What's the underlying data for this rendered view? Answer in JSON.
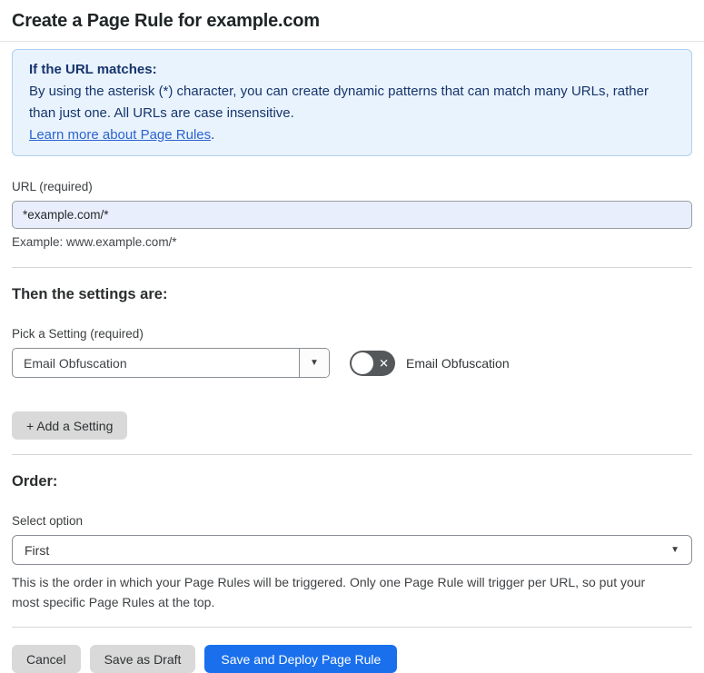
{
  "page": {
    "title": "Create a Page Rule for example.com"
  },
  "info_box": {
    "heading": "If the URL matches:",
    "body": "By using the asterisk (*) character, you can create dynamic patterns that can match many URLs, rather than just one. All URLs are case insensitive.",
    "link_label": "Learn more about Page Rules",
    "link_suffix": "."
  },
  "url_field": {
    "label": "URL (required)",
    "value": "*example.com/*",
    "helper": "Example: www.example.com/*"
  },
  "settings_section": {
    "heading": "Then the settings are:",
    "picker_label": "Pick a Setting (required)",
    "picker_value": "Email Obfuscation",
    "toggle_label": "Email Obfuscation",
    "toggle_state": "off",
    "add_setting_label": "+ Add a Setting"
  },
  "order_section": {
    "heading": "Order:",
    "select_label": "Select option",
    "select_value": "First",
    "helper": "This is the order in which your Page Rules will be triggered. Only one Page Rule will trigger per URL, so put your most specific Page Rules at the top."
  },
  "footer": {
    "cancel_label": "Cancel",
    "save_draft_label": "Save as Draft",
    "save_deploy_label": "Save and Deploy Page Rule"
  },
  "icons": {
    "dropdown_arrow_char": "▼",
    "toggle_x_char": "✕"
  },
  "colors": {
    "accent_blue": "#1a70ec",
    "info_bg": "#e9f3fd",
    "info_border": "#aed0ee",
    "info_text": "#16356c",
    "link_blue": "#2c63cf",
    "url_input_bg": "#e8eefb",
    "toggle_off_bg": "#54585a",
    "gray_button_bg": "#d9d9d9"
  }
}
